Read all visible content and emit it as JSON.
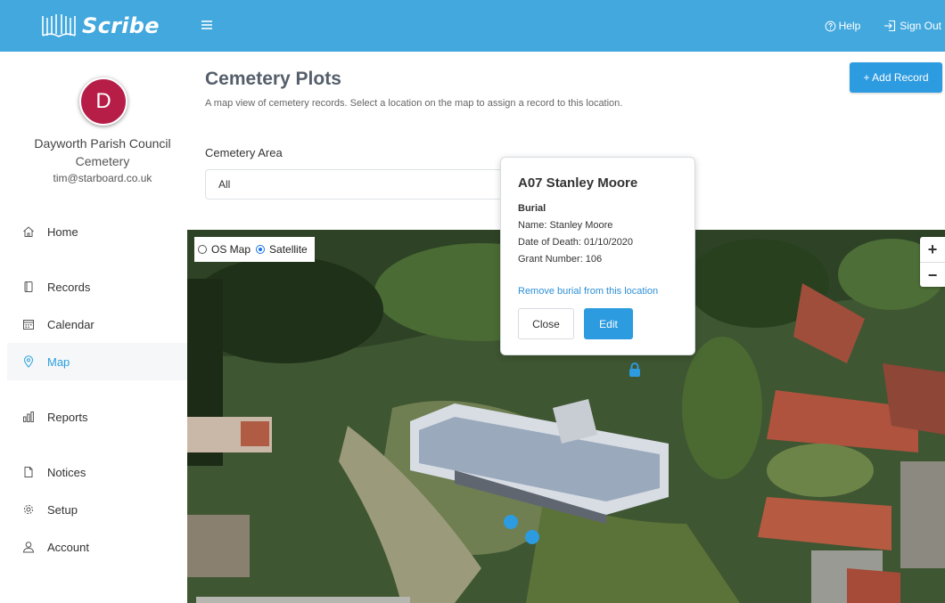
{
  "app": {
    "brand": "Scribe",
    "help_label": "Help",
    "signout_label": "Sign Out"
  },
  "user": {
    "initial": "D",
    "org_name": "Dayworth Parish Council",
    "org_sub": "Cemetery",
    "email": "tim@starboard.co.uk"
  },
  "nav": [
    {
      "label": "Home",
      "icon": "home-icon"
    },
    {
      "label": "Records",
      "icon": "book-icon"
    },
    {
      "label": "Calendar",
      "icon": "calendar-icon"
    },
    {
      "label": "Map",
      "icon": "map-pin-icon"
    },
    {
      "label": "Reports",
      "icon": "bar-chart-icon"
    },
    {
      "label": "Notices",
      "icon": "document-icon"
    },
    {
      "label": "Setup",
      "icon": "gear-icon"
    },
    {
      "label": "Account",
      "icon": "user-icon"
    }
  ],
  "active_nav": "Map",
  "page": {
    "title": "Cemetery Plots",
    "description": "A map view of cemetery records. Select a location on the map to assign a record to this location.",
    "add_button": "+ Add Record",
    "area_label": "Cemetery Area",
    "area_value": "All"
  },
  "map": {
    "layer_os": "OS Map",
    "layer_satellite": "Satellite",
    "selected_layer": "Satellite",
    "zoom_in": "+",
    "zoom_out": "−"
  },
  "popup": {
    "title": "A07 Stanley Moore",
    "type": "Burial",
    "name_line": "Name: Stanley Moore",
    "death_line": "Date of Death: 01/10/2020",
    "grant_line": "Grant Number: 106",
    "remove_link": "Remove burial from this location",
    "close_label": "Close",
    "edit_label": "Edit"
  },
  "colors": {
    "topbar": "#42a8de",
    "accent": "#2d9be0",
    "avatar": "#b61e48"
  }
}
